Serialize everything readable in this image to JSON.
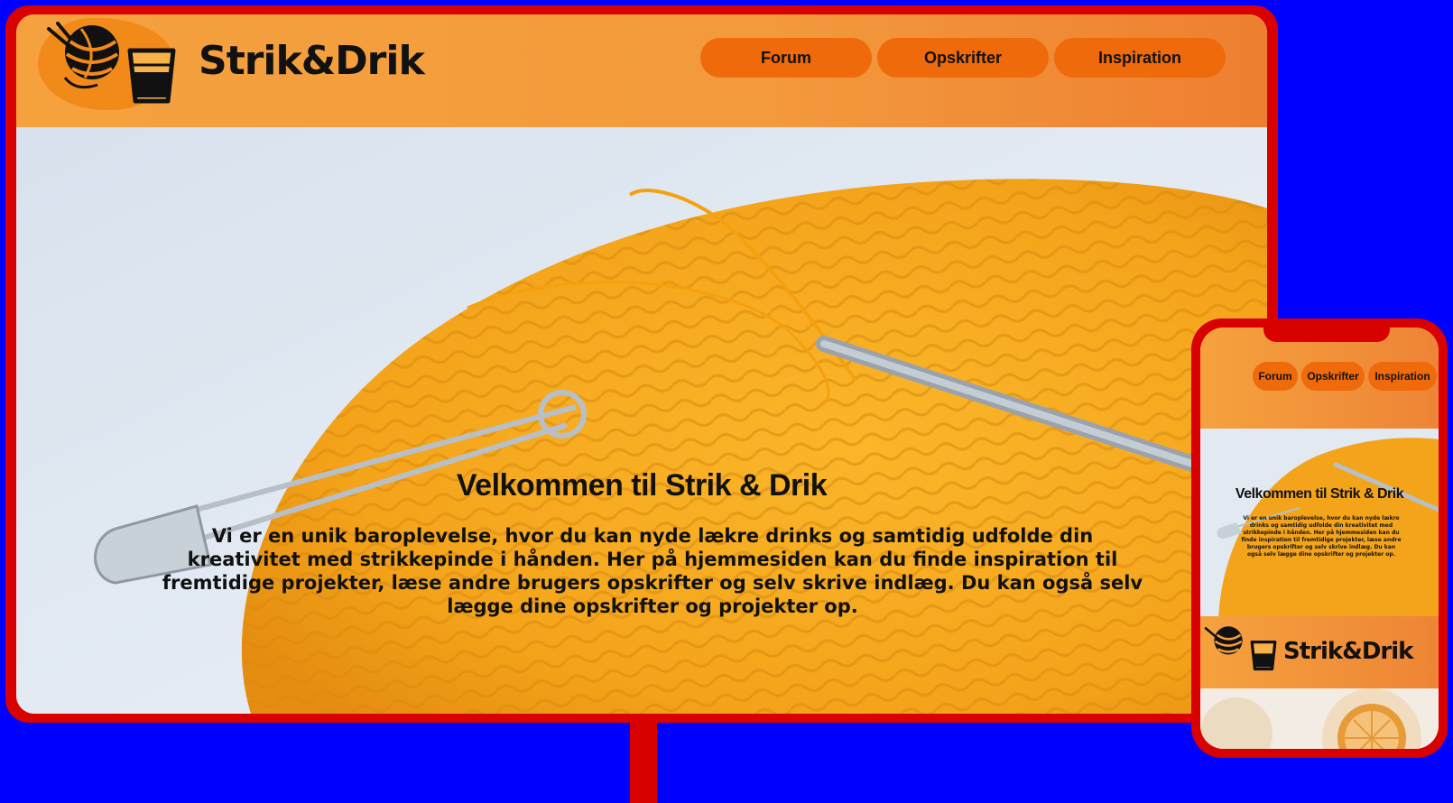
{
  "brand": {
    "name": "Strik&Drik"
  },
  "nav": {
    "items": [
      {
        "label": "Forum"
      },
      {
        "label": "Opskrifter"
      },
      {
        "label": "Inspiration"
      }
    ]
  },
  "hero": {
    "title": "Velkommen til Strik & Drik",
    "text": "Vi er en unik baroplevelse, hvor du kan nyde lækre drinks og samtidig udfolde din kreativitet med strikkepinde i hånden. Her på hjemmesiden kan du finde inspiration til fremtidige projekter, læse andre brugers opskrifter og selv skrive indlæg. Du kan også selv lægge dine opskrifter og projekter op."
  },
  "colors": {
    "background": "#0000ff",
    "device_frame": "#d90000",
    "header": "#f39a3c",
    "nav_button": "#ef6a0a",
    "knit": "#f5a81e"
  },
  "icons": [
    "yarn-ball-icon",
    "glass-icon"
  ]
}
